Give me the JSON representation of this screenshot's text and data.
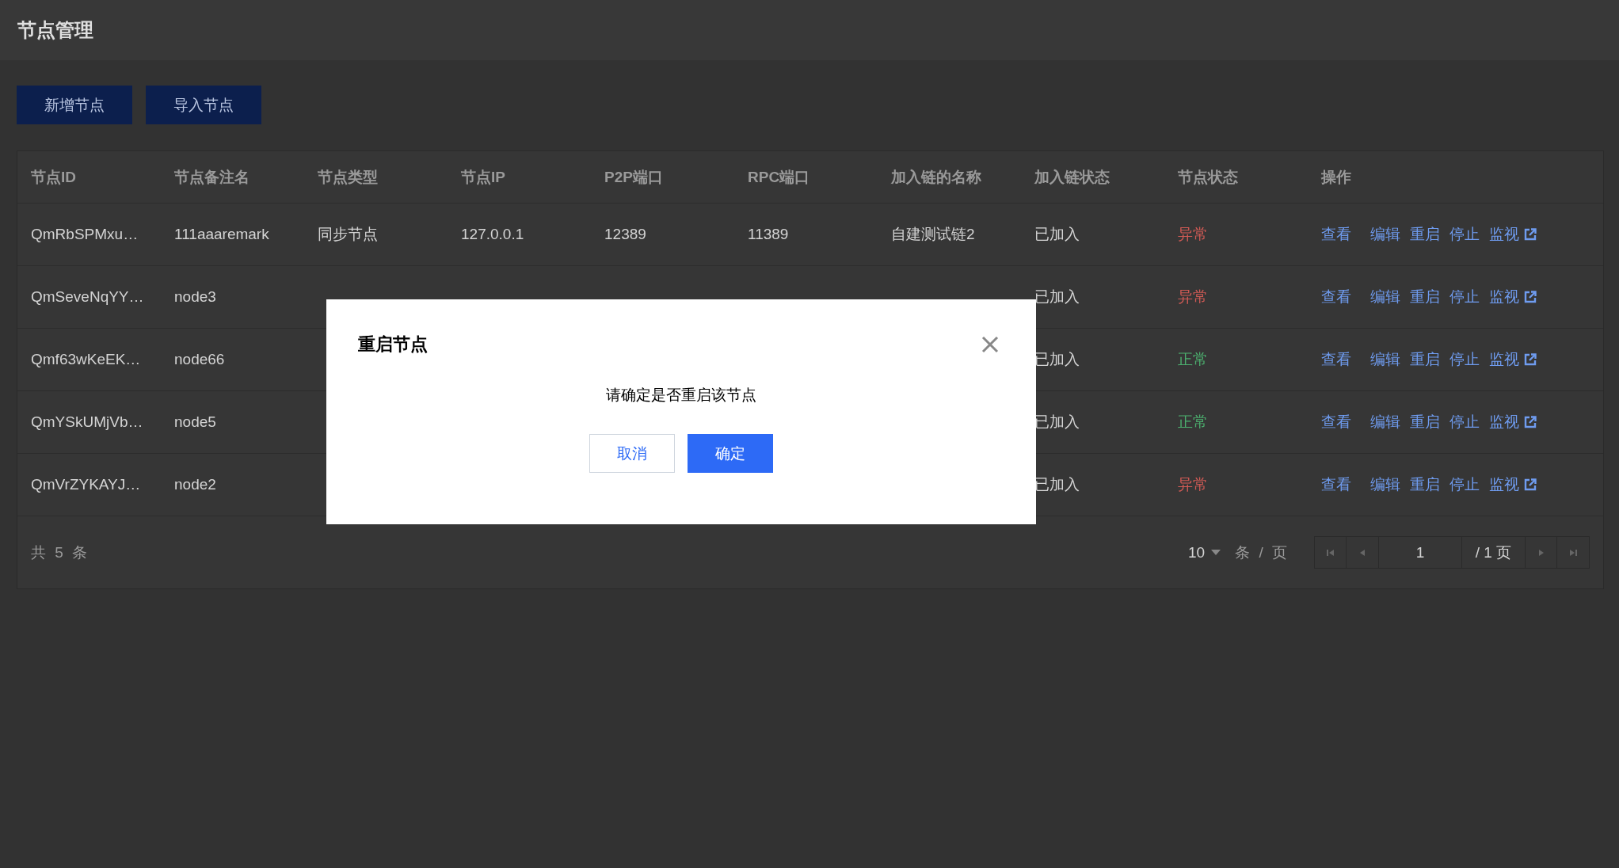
{
  "page": {
    "title": "节点管理"
  },
  "toolbar": {
    "buttons": [
      "新增节点",
      "导入节点"
    ]
  },
  "table": {
    "columns": [
      "节点ID",
      "节点备注名",
      "节点类型",
      "节点IP",
      "P2P端口",
      "RPC端口",
      "加入链的名称",
      "加入链状态",
      "节点状态",
      "操作"
    ],
    "rows": [
      {
        "id": "QmRbSPMxu…",
        "remark": "111aaaremark",
        "type": "同步节点",
        "ip": "127.0.0.1",
        "p2p_port": "12389",
        "rpc_port": "11389",
        "chain_name": "自建测试链2",
        "chain_status": "已加入",
        "node_status": {
          "text": "异常",
          "color": "#d05a55"
        },
        "actions": [
          "查看",
          "编辑",
          "重启",
          "停止",
          "监视"
        ]
      },
      {
        "id": "QmSeveNqYY…",
        "remark": "node3",
        "chain_status": "已加入",
        "node_status": {
          "text": "异常",
          "color": "#d05a55"
        },
        "actions": [
          "查看",
          "编辑",
          "重启",
          "停止",
          "监视"
        ]
      },
      {
        "id": "Qmf63wKeEK…",
        "remark": "node66",
        "chain_status": "已加入",
        "node_status": {
          "text": "正常",
          "color": "#4caf6e"
        },
        "actions": [
          "查看",
          "编辑",
          "重启",
          "停止",
          "监视"
        ]
      },
      {
        "id": "QmYSkUMjVb…",
        "remark": "node5",
        "chain_status": "已加入",
        "node_status": {
          "text": "正常",
          "color": "#4caf6e"
        },
        "actions": [
          "查看",
          "编辑",
          "重启",
          "停止",
          "监视"
        ]
      },
      {
        "id": "QmVrZYKAYJ…",
        "remark": "node2",
        "chain_status": "已加入",
        "node_status": {
          "text": "异常",
          "color": "#d05a55"
        },
        "actions": [
          "查看",
          "编辑",
          "重启",
          "停止",
          "监视"
        ]
      }
    ]
  },
  "pagination": {
    "total": "共 5 条",
    "page_size": "10",
    "page_size_unit": "条 / 页",
    "page": "1",
    "page_count": "/ 1 页"
  },
  "modal": {
    "title": "重启节点",
    "message": "请确定是否重启该节点",
    "buttons": [
      {
        "kind": "cancel",
        "label": "取消"
      },
      {
        "kind": "confirm",
        "label": "确定"
      }
    ]
  }
}
